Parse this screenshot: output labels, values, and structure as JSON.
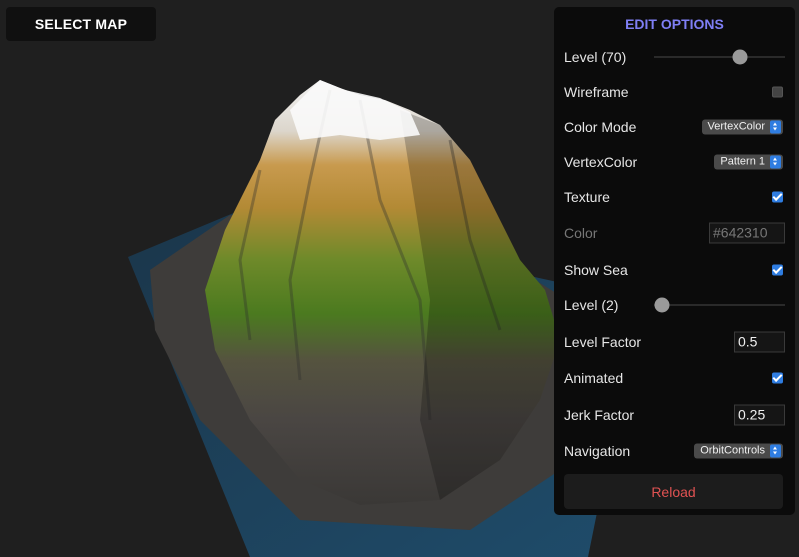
{
  "toolbar": {
    "select_map_label": "SELECT MAP"
  },
  "panel": {
    "title": "EDIT OPTIONS",
    "level": {
      "label": "Level (70)",
      "value": 70,
      "fraction": 0.66
    },
    "wireframe": {
      "label": "Wireframe",
      "checked": false
    },
    "color_mode": {
      "label": "Color Mode",
      "value": "VertexColor"
    },
    "vertex_color": {
      "label": "VertexColor",
      "value": "Pattern 1"
    },
    "texture": {
      "label": "Texture",
      "checked": true
    },
    "color": {
      "label": "Color",
      "value": "#642310"
    },
    "show_sea": {
      "label": "Show Sea",
      "checked": true
    },
    "sea_level": {
      "label": "Level (2)",
      "value": 2,
      "fraction": 0.06
    },
    "level_factor": {
      "label": "Level Factor",
      "value": "0.5"
    },
    "animated": {
      "label": "Animated",
      "checked": true
    },
    "jerk_factor": {
      "label": "Jerk Factor",
      "value": "0.25"
    },
    "navigation": {
      "label": "Navigation",
      "value": "OrbitControls"
    },
    "reload_label": "Reload"
  },
  "colors": {
    "accent": "#7f7ff5",
    "reload": "#e05252",
    "checkbox_on": "#2f7de1",
    "sea": "#1f4d6e"
  }
}
